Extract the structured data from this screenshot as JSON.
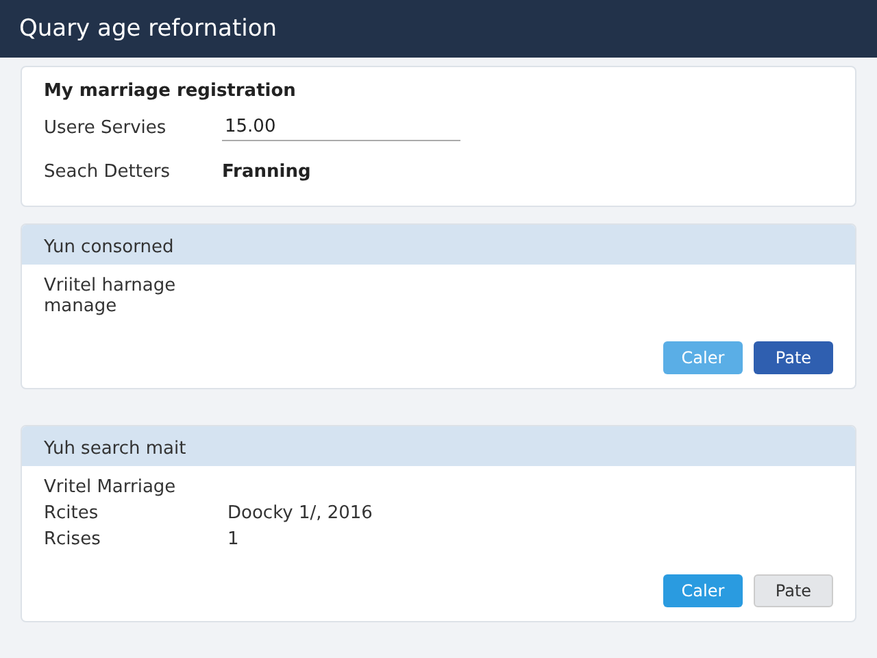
{
  "window": {
    "title": "Quary age refornation"
  },
  "registration": {
    "heading": "My marriage registration",
    "fields": [
      {
        "label": "Usere Servies",
        "kind": "input",
        "value": "15.00"
      },
      {
        "label": "Seach Detters",
        "kind": "text",
        "value": "Franning"
      }
    ]
  },
  "panels": [
    {
      "title": "Yun consorned",
      "lines": [
        {
          "label": "Vriitel harnage manage"
        }
      ],
      "buttons": [
        {
          "label": "Caler",
          "kind": "light"
        },
        {
          "label": "Pate",
          "kind": "dark"
        }
      ]
    },
    {
      "title": "Yuh search mait",
      "lines": [
        {
          "label": "Vritel Marriage"
        },
        {
          "label": "Rcites",
          "value": "Doocky 1/, 2016"
        },
        {
          "label": "Rcises",
          "value": "1"
        }
      ],
      "buttons": [
        {
          "label": "Caler",
          "kind": "primary"
        },
        {
          "label": "Pate",
          "kind": "secondary"
        }
      ]
    }
  ]
}
